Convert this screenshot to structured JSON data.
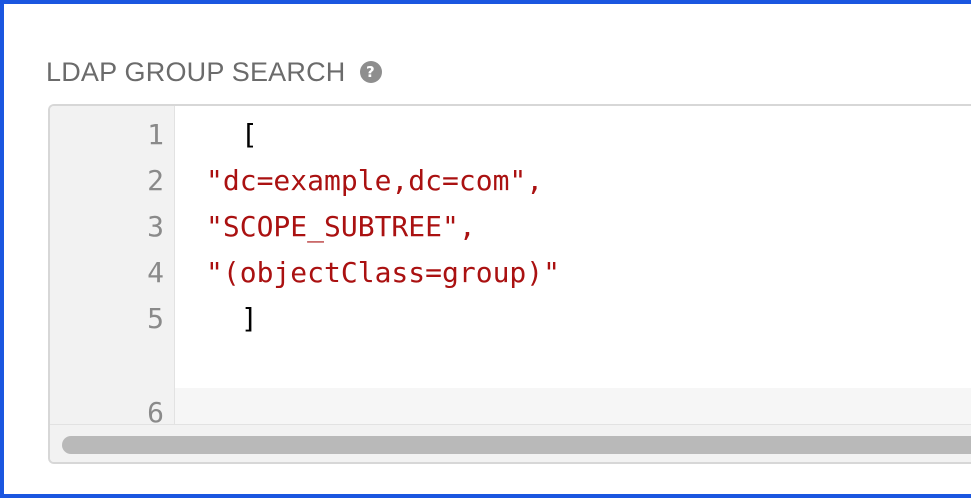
{
  "field": {
    "label": "LDAP GROUP SEARCH",
    "help_icon": "question-circle-icon"
  },
  "editor": {
    "lines": [
      {
        "number": "1",
        "text": " ["
      },
      {
        "number": "2",
        "text": "\"dc=example,dc=com\","
      },
      {
        "number": "3",
        "text": "\"SCOPE_SUBTREE\","
      },
      {
        "number": "4",
        "text": "\"(objectClass=group)\""
      },
      {
        "number": "5",
        "text": " ]"
      },
      {
        "number": "6",
        "text": ""
      }
    ]
  },
  "colors": {
    "focus_border": "#1a56e0",
    "string": "#aa1111",
    "line_number": "#8a8a8a",
    "label": "#6b6b6b"
  }
}
